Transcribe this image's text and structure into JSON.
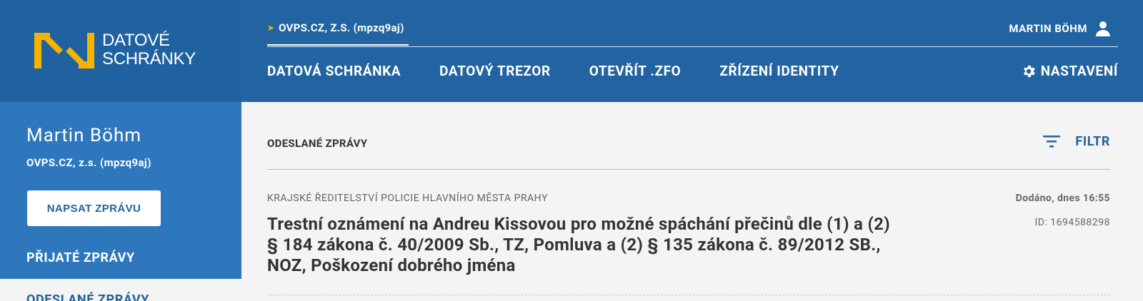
{
  "logo": {
    "line1": "DATOVÉ",
    "line2": "SCHRÁNKY",
    "icon": "datove-schranky-logo",
    "color": "#f6b300"
  },
  "header": {
    "account_arrow": "➤",
    "account_label": "OVPS.CZ, Z.S. (mpzq9aj)",
    "user_name": "MARTIN BÖHM",
    "user_icon": "person-icon",
    "nav": [
      "DATOVÁ SCHRÁNKA",
      "DATOVÝ TREZOR",
      "OTEVŘÍT .ZFO",
      "ZŘÍZENÍ IDENTITY"
    ],
    "settings_label": "NASTAVENÍ",
    "settings_icon": "gear-icon",
    "bg_color": "#2263a1"
  },
  "sidebar": {
    "name": "Martin Böhm",
    "org": "OVPS.CZ, z.s. (mpzq9aj)",
    "compose_label": "NAPSAT ZPRÁVU",
    "received_label": "PŘIJATÉ ZPRÁVY",
    "sent_label": "ODESLANÉ ZPRÁVY",
    "bg_color": "#2e77bd"
  },
  "main": {
    "section_title": "ODESLANÉ ZPRÁVY",
    "filter_label": "FILTR",
    "filter_icon": "filter-icon",
    "messages": [
      {
        "sender": "KRAJSKÉ ŘEDITELSTVÍ POLICIE HLAVNÍHO MĚSTA PRAHY",
        "status": "Dodáno, dnes 16:55",
        "id": "ID: 1694588298",
        "subject": "Trestní oznámení na Andreu Kissovou pro možné spáchání přečinů dle (1) a (2) § 184 zákona č. 40/2009 Sb., TZ, Pomluva a (2) § 135 zákona č. 89/2012 SB., NOZ, Poškození dobrého jména"
      }
    ]
  }
}
